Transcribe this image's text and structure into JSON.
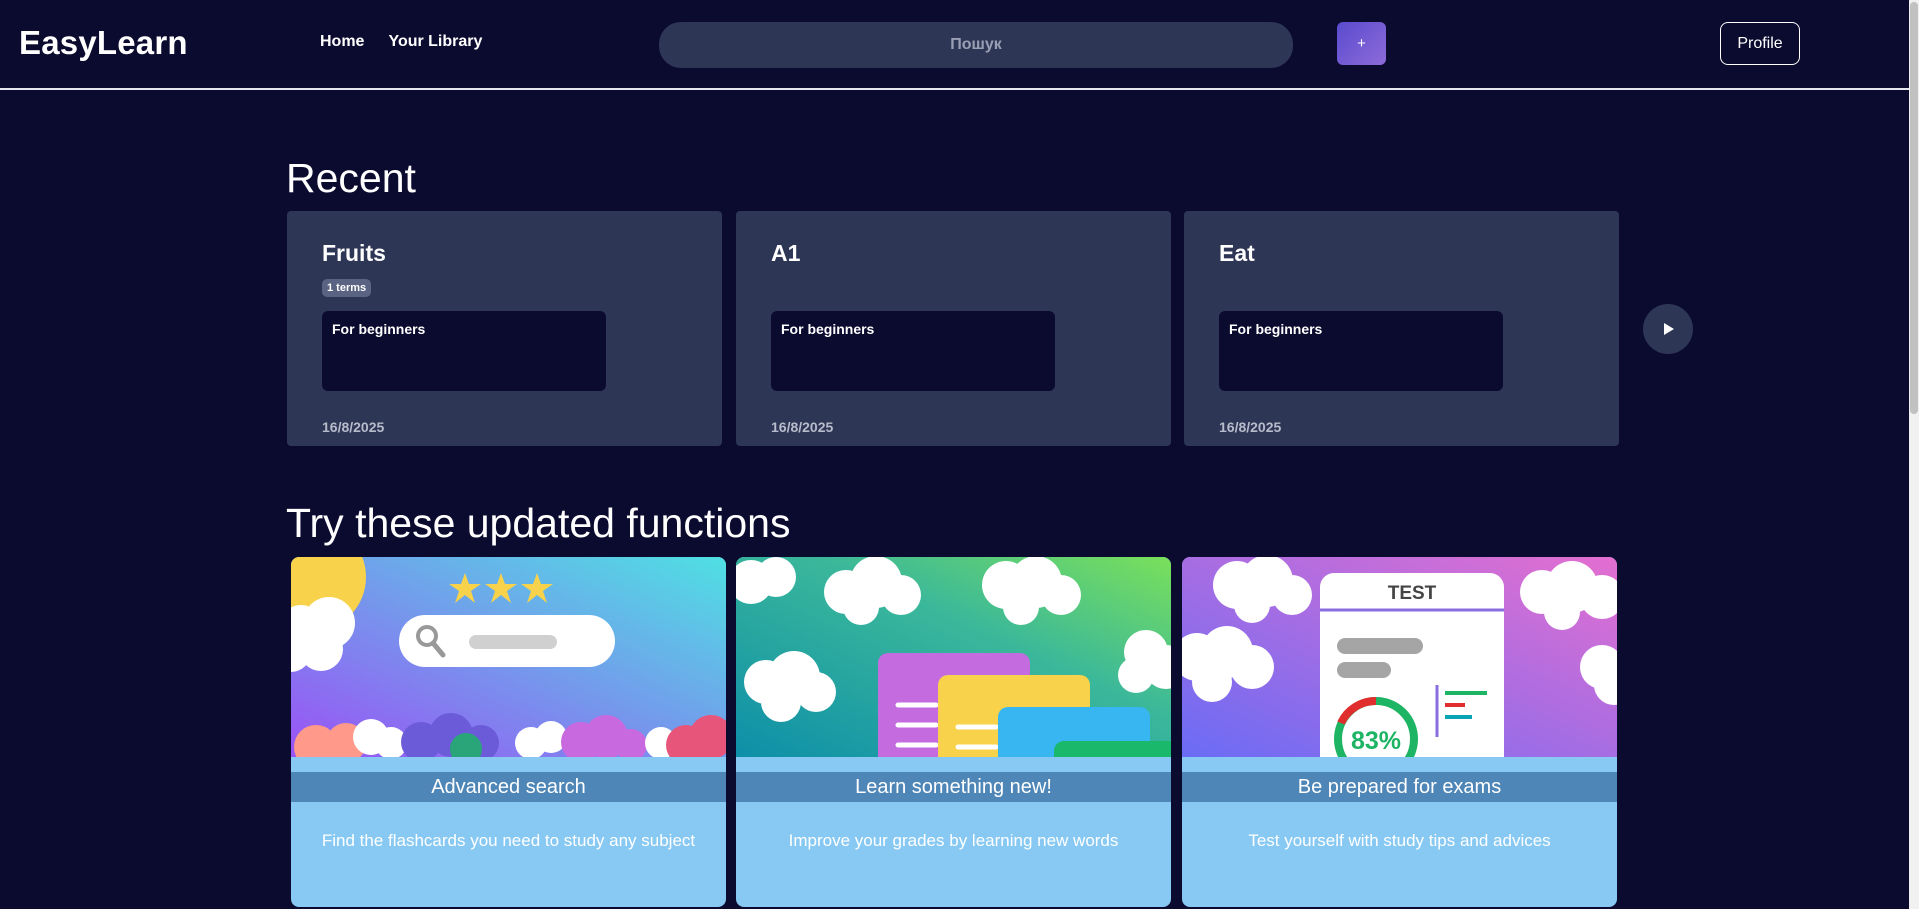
{
  "header": {
    "logo": "EasyLearn",
    "nav": [
      "Home",
      "Your Library"
    ],
    "search_placeholder": "Пошук",
    "add_label": "+",
    "profile_label": "Profile"
  },
  "recent": {
    "title": "Recent",
    "cards": [
      {
        "title": "Fruits",
        "badge": "1 terms",
        "description": "For beginners",
        "date": "16/8/2025"
      },
      {
        "title": "A1",
        "badge": "",
        "description": "For beginners",
        "date": "16/8/2025"
      },
      {
        "title": "Eat",
        "badge": "",
        "description": "For beginners",
        "date": "16/8/2025"
      }
    ]
  },
  "features": {
    "title": "Try these updated functions",
    "cards": [
      {
        "title": "Advanced search",
        "text": "Find the flashcards you need to study any subject"
      },
      {
        "title": "Learn something new!",
        "text": "Improve your grades by learning new words"
      },
      {
        "title": "Be prepared for exams",
        "text": "Test yourself with study tips and advices"
      }
    ],
    "test_label": "TEST",
    "score_label": "83%"
  }
}
